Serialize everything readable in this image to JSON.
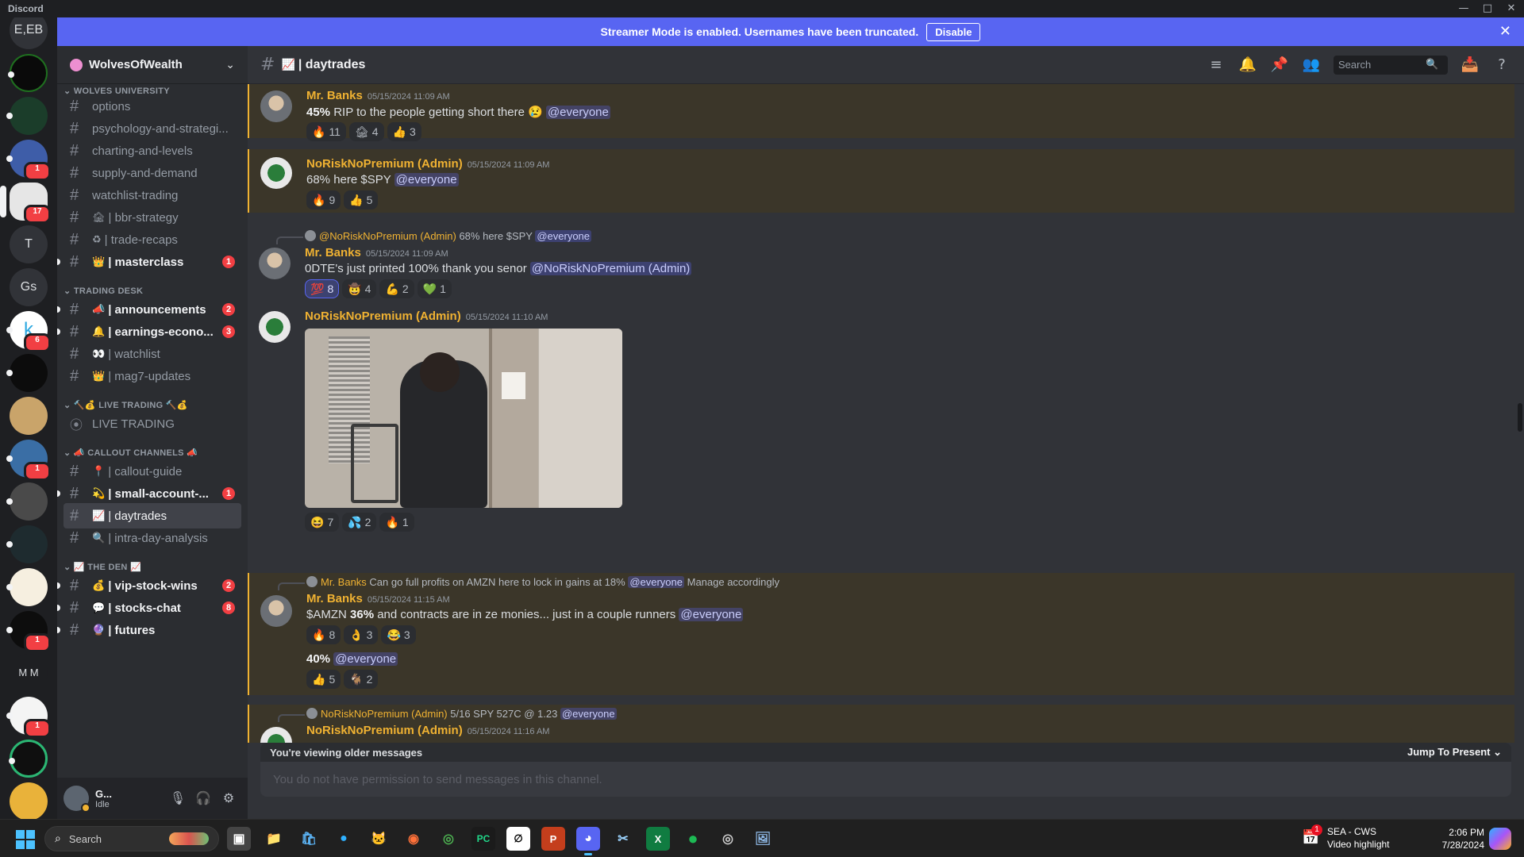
{
  "window": {
    "app_name": "Discord"
  },
  "banner": {
    "text": "Streamer Mode is enabled. Usernames have been truncated.",
    "button": "Disable"
  },
  "server_rail": [
    {
      "label": "E,EB",
      "badge": ""
    },
    {
      "label": "",
      "badge": ""
    },
    {
      "label": "",
      "badge": ""
    },
    {
      "label": "",
      "badge": "1"
    },
    {
      "label": "",
      "badge": "17"
    },
    {
      "label": "T",
      "badge": ""
    },
    {
      "label": "Gs",
      "badge": ""
    },
    {
      "label": "k",
      "badge": "6"
    },
    {
      "label": "",
      "badge": ""
    },
    {
      "label": "",
      "badge": ""
    },
    {
      "label": "",
      "badge": "1"
    },
    {
      "label": "",
      "badge": ""
    },
    {
      "label": "",
      "badge": ""
    },
    {
      "label": "",
      "badge": ""
    },
    {
      "label": "",
      "badge": "1"
    },
    {
      "label": "M M",
      "badge": ""
    },
    {
      "label": "",
      "badge": "1"
    },
    {
      "label": "",
      "badge": ""
    }
  ],
  "server": {
    "name": "WolvesOfWealth"
  },
  "categories": {
    "c1": "WOLVES UNIVERSITY",
    "c2": "TRADING DESK",
    "c3": "LIVE TRADING",
    "c4": "CALLOUT CHANNELS",
    "c5": "THE DEN"
  },
  "channels": [
    {
      "name": "options",
      "emoji": "",
      "badge": ""
    },
    {
      "name": "psychology-and-strategi...",
      "emoji": "",
      "badge": ""
    },
    {
      "name": "charting-and-levels",
      "emoji": "",
      "badge": ""
    },
    {
      "name": "supply-and-demand",
      "emoji": "",
      "badge": ""
    },
    {
      "name": "watchlist-trading",
      "emoji": "",
      "badge": ""
    },
    {
      "name": "| bbr-strategy",
      "emoji": "🏚",
      "badge": ""
    },
    {
      "name": "| trade-recaps",
      "emoji": "♻",
      "badge": ""
    },
    {
      "name": "| masterclass",
      "emoji": "👑",
      "badge": "1"
    },
    {
      "name": "| announcements",
      "emoji": "📣",
      "badge": "2"
    },
    {
      "name": "| earnings-econo...",
      "emoji": "🔔",
      "badge": "3"
    },
    {
      "name": "| watchlist",
      "emoji": "👀",
      "badge": ""
    },
    {
      "name": "| mag7-updates",
      "emoji": "👑",
      "badge": ""
    },
    {
      "name": "LIVE TRADING",
      "emoji": "",
      "badge": ""
    },
    {
      "name": "| callout-guide",
      "emoji": "📍",
      "badge": ""
    },
    {
      "name": "| small-account-...",
      "emoji": "💫",
      "badge": "1"
    },
    {
      "name": "| daytrades",
      "emoji": "📈",
      "badge": ""
    },
    {
      "name": "| intra-day-analysis",
      "emoji": "🔍",
      "badge": ""
    },
    {
      "name": "| vip-stock-wins",
      "emoji": "💰",
      "badge": "2"
    },
    {
      "name": "| stocks-chat",
      "emoji": "💬",
      "badge": "8"
    },
    {
      "name": "| futures",
      "emoji": "🔮",
      "badge": ""
    }
  ],
  "user": {
    "name": "G...",
    "status": "Idle"
  },
  "channel_header": {
    "title": "| daytrades",
    "emoji": "📈",
    "search_placeholder": "Search"
  },
  "messages": [
    {
      "author": "Mr. Banks",
      "time": "05/15/2024 11:09 AM",
      "bold": "45%",
      "text": " RIP to the people getting short there 😢 ",
      "mention": "@everyone",
      "reactions": [
        {
          "e": "🔥",
          "n": "11"
        },
        {
          "e": "🏚",
          "n": "4"
        },
        {
          "e": "👍",
          "n": "3"
        }
      ]
    },
    {
      "author": "NoRiskNoPremium (Admin)",
      "time": "05/15/2024 11:09 AM",
      "text": "68% here $SPY ",
      "mention": "@everyone",
      "reactions": [
        {
          "e": "🔥",
          "n": "9"
        },
        {
          "e": "👍",
          "n": "5"
        }
      ]
    },
    {
      "reply_author": "@NoRiskNoPremium (Admin)",
      "reply_text": " 68% here $SPY ",
      "reply_mention": "@everyone",
      "author": "Mr. Banks",
      "time": "05/15/2024 11:09 AM",
      "text": "0DTE's just printed 100% thank you senor ",
      "mention": "@NoRiskNoPremium (Admin)",
      "reactions": [
        {
          "e": "💯",
          "n": "8"
        },
        {
          "e": "🤠",
          "n": "4"
        },
        {
          "e": "💪",
          "n": "2"
        },
        {
          "e": "💚",
          "n": "1"
        }
      ]
    },
    {
      "author": "NoRiskNoPremium (Admin)",
      "time": "05/15/2024 11:10 AM",
      "reactions": [
        {
          "e": "😆",
          "n": "7"
        },
        {
          "e": "💦",
          "n": "2"
        },
        {
          "e": "🔥",
          "n": "1"
        }
      ]
    },
    {
      "reply_author": "Mr. Banks",
      "reply_text": " Can go full profits on AMZN here to lock in gains at 18% ",
      "reply_mention": "@everyone",
      "reply_tail": " Manage accordingly",
      "author": "Mr. Banks",
      "time": "05/15/2024 11:15 AM",
      "pre": "$AMZN ",
      "bold": "36%",
      "text": " and contracts are in ze monies... just in a couple runners ",
      "mention": "@everyone",
      "reactions": [
        {
          "e": "🔥",
          "n": "8"
        },
        {
          "e": "👌",
          "n": "3"
        },
        {
          "e": "😂",
          "n": "3"
        }
      ],
      "followup_bold": "40%",
      "followup_mention": "@everyone",
      "followup_reactions": [
        {
          "e": "👍",
          "n": "5"
        },
        {
          "e": "🐐",
          "n": "2"
        }
      ]
    },
    {
      "reply_author": "NoRiskNoPremium (Admin)",
      "reply_text": " 5/16 SPY 527C @ 1.23 ",
      "reply_mention": "@everyone",
      "author": "NoRiskNoPremium (Admin)",
      "time": "05/15/2024 11:16 AM"
    }
  ],
  "older_bar": {
    "label": "You're viewing older messages",
    "jump": "Jump To Present"
  },
  "composer": {
    "placeholder": "You do not have permission to send messages in this channel."
  },
  "taskbar": {
    "search_placeholder": "Search",
    "weather_badge": "1",
    "weather_line1": "SEA - CWS",
    "weather_line2": "Video highlight",
    "time": "2:06 PM",
    "date": "7/28/2024"
  },
  "colors": {
    "accent": "#5865f2",
    "mention_highlight": "#f0b232",
    "unread_badge": "#f23f43"
  }
}
